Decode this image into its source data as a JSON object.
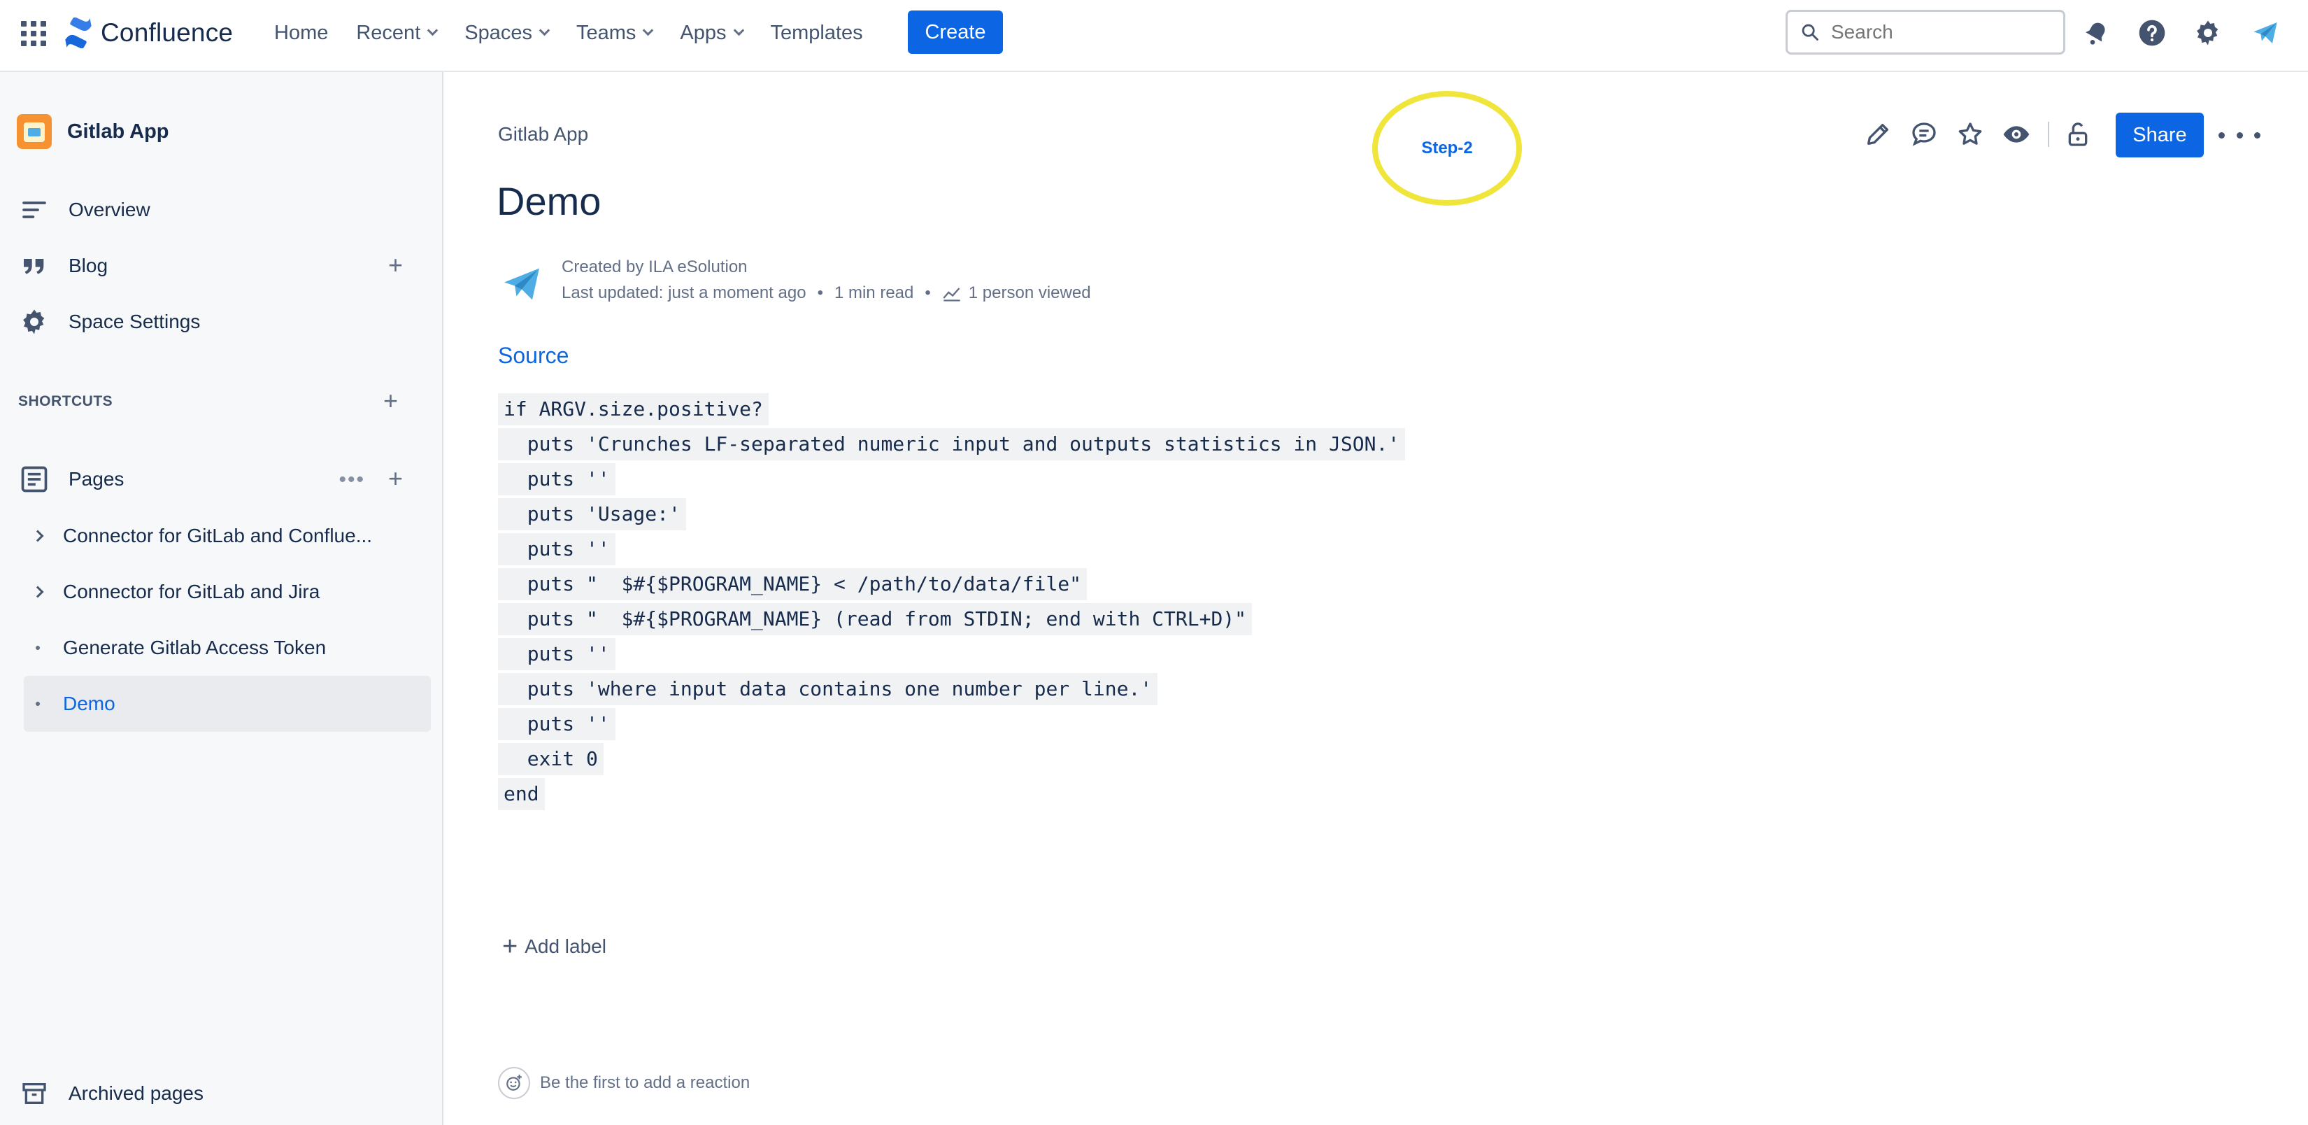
{
  "topbar": {
    "app_name": "Confluence",
    "nav": [
      {
        "label": "Home",
        "has_dropdown": false
      },
      {
        "label": "Recent",
        "has_dropdown": true
      },
      {
        "label": "Spaces",
        "has_dropdown": true
      },
      {
        "label": "Teams",
        "has_dropdown": true
      },
      {
        "label": "Apps",
        "has_dropdown": true
      },
      {
        "label": "Templates",
        "has_dropdown": false
      }
    ],
    "create_label": "Create",
    "search_placeholder": "Search",
    "icons": [
      "notifications-icon",
      "help-icon",
      "settings-icon",
      "profile-avatar-icon"
    ]
  },
  "sidebar": {
    "space_name": "Gitlab App",
    "items": [
      {
        "label": "Overview",
        "icon": "overview-icon"
      },
      {
        "label": "Blog",
        "icon": "quote-icon"
      },
      {
        "label": "Space Settings",
        "icon": "gear-icon"
      }
    ],
    "shortcuts_label": "SHORTCUTS",
    "pages_label": "Pages",
    "page_tree": [
      {
        "label": "Connector for GitLab and Conflue...",
        "type": "expandable"
      },
      {
        "label": "Connector for GitLab and Jira",
        "type": "expandable"
      },
      {
        "label": "Generate Gitlab Access Token",
        "type": "leaf"
      },
      {
        "label": "Demo",
        "type": "leaf",
        "active": true
      }
    ],
    "archived_label": "Archived pages"
  },
  "page": {
    "breadcrumb": "Gitlab App",
    "step_annotation": "Step-2",
    "share_label": "Share",
    "title": "Demo",
    "created_by": "Created by ILA eSolution",
    "last_updated": "Last updated: just a moment ago",
    "read_time": "1 min read",
    "views": "1 person viewed",
    "section_heading": "Source",
    "code_lines": [
      "if ARGV.size.positive?",
      "  puts 'Crunches LF-separated numeric input and outputs statistics in JSON.'",
      "  puts ''",
      "  puts 'Usage:'",
      "  puts ''",
      "  puts \"  $#{$PROGRAM_NAME} < /path/to/data/file\"",
      "  puts \"  $#{$PROGRAM_NAME} (read from STDIN; end with CTRL+D)\"",
      "  puts ''",
      "  puts 'where input data contains one number per line.'",
      "  puts ''",
      "  exit 0",
      "end"
    ],
    "add_label": "Add label",
    "reaction_prompt": "Be the first to add a reaction"
  },
  "colors": {
    "accent": "#0c66e4",
    "text": "#172b4d",
    "subtle": "#626f86",
    "highlight_ring": "#f0e53a",
    "sidebar_bg": "#f7f8f9"
  }
}
